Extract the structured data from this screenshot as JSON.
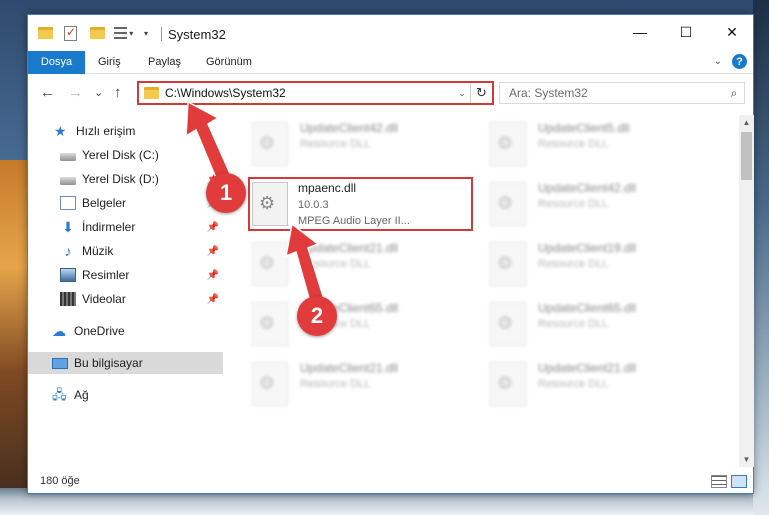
{
  "window": {
    "title": "System32",
    "minimize": "—",
    "maximize": "☐",
    "close": "✕"
  },
  "ribbon": {
    "tabs": [
      "Dosya",
      "Giriş",
      "Paylaş",
      "Görünüm"
    ],
    "help": "?"
  },
  "nav": {
    "back": "←",
    "forward": "→",
    "recent": "⌄",
    "up": "↑"
  },
  "address": {
    "path": "C:\\Windows\\System32",
    "refresh": "↻"
  },
  "search": {
    "placeholder": "Ara: System32",
    "icon": "search-icon"
  },
  "sidebar": {
    "items": [
      {
        "label": "Hızlı erişim",
        "icon": "quick-access-star-icon"
      },
      {
        "label": "Yerel Disk (C:)",
        "icon": "drive-icon"
      },
      {
        "label": "Yerel Disk (D:)",
        "icon": "drive-icon"
      },
      {
        "label": "Belgeler",
        "icon": "documents-icon"
      },
      {
        "label": "İndirmeler",
        "icon": "downloads-icon"
      },
      {
        "label": "Müzik",
        "icon": "music-icon"
      },
      {
        "label": "Resimler",
        "icon": "pictures-icon"
      },
      {
        "label": "Videolar",
        "icon": "videos-icon"
      },
      {
        "label": "OneDrive",
        "icon": "onedrive-icon"
      },
      {
        "label": "Bu bilgisayar",
        "icon": "this-pc-icon"
      },
      {
        "label": "Ağ",
        "icon": "network-icon"
      }
    ]
  },
  "files": {
    "highlighted": {
      "name": "mpaenc.dll",
      "version": "10.0.3",
      "description": "MPEG Audio Layer II..."
    },
    "blurred": [
      {
        "name": "UpdateClient42.dll",
        "desc": "Resource DLL"
      },
      {
        "name": "UpdateClient5.dll",
        "desc": "Resource DLL"
      },
      {
        "name": "UpdateClient42.dll",
        "desc": "Resource DLL"
      },
      {
        "name": "UpdateClient21.dll",
        "desc": "Resource DLL"
      },
      {
        "name": "UpdateClient19.dll",
        "desc": "Resource DLL"
      },
      {
        "name": "UpdateClient65.dll",
        "desc": "Resource DLL"
      },
      {
        "name": "UpdateClient65.dll",
        "desc": "Resource DLL"
      },
      {
        "name": "UpdateClient21.dll",
        "desc": "Resource DLL"
      },
      {
        "name": "UpdateClient21.dll",
        "desc": "Resource DLL"
      }
    ]
  },
  "status": {
    "count": "180 öğe"
  },
  "callouts": {
    "one": "1",
    "two": "2",
    "color": "#e23b3b"
  }
}
